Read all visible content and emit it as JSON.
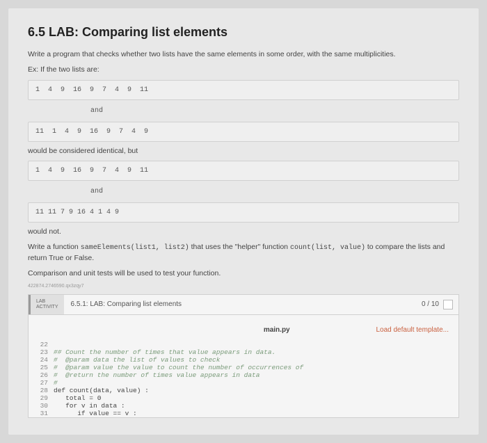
{
  "title": "6.5 LAB: Comparing list elements",
  "desc1": "Write a program that checks whether two lists have the same elements in some order, with the same multiplicities.",
  "desc2": "Ex: If the two lists are:",
  "code1": "1  4  9  16  9  7  4  9  11",
  "and": "and",
  "code2": "11  1  4  9  16  9  7  4  9",
  "desc3": "would be considered identical, but",
  "code3": "1  4  9  16  9  7  4  9  11",
  "code4": "11 11 7 9 16 4 1 4 9",
  "desc4": "would not.",
  "desc5_pre": "Write a function ",
  "desc5_code1": "sameElements(list1, list2)",
  "desc5_mid": " that uses the \"helper\" function ",
  "desc5_code2": "count(list, value)",
  "desc5_post": " to compare the lists and return True or False.",
  "desc6": "Comparison and unit tests will be used to test your function.",
  "tiny": "422874.2746590.qx3zqy7",
  "lab_tag1": "LAB",
  "lab_tag2": "ACTIVITY",
  "lab_title": "6.5.1: LAB: Comparing list elements",
  "lab_score": "0 / 10",
  "filename": "main.py",
  "loadlink": "Load default template...",
  "lines": [
    {
      "n": "22",
      "kind": "",
      "t": ""
    },
    {
      "n": "23",
      "kind": "cmt",
      "t": "## Count the number of times that value appears in data."
    },
    {
      "n": "24",
      "kind": "cmt",
      "t": "#  @param data the list of values to check"
    },
    {
      "n": "25",
      "kind": "cmt",
      "t": "#  @param value the value to count the number of occurrences of"
    },
    {
      "n": "26",
      "kind": "cmt",
      "t": "#  @return the number of times value appears in data"
    },
    {
      "n": "27",
      "kind": "cmt",
      "t": "#"
    },
    {
      "n": "28",
      "kind": "",
      "t": "def count(data, value) :"
    },
    {
      "n": "29",
      "kind": "",
      "t": "   total = 0"
    },
    {
      "n": "30",
      "kind": "",
      "t": "   for v in data :"
    },
    {
      "n": "31",
      "kind": "",
      "t": "      if value == v :"
    }
  ]
}
